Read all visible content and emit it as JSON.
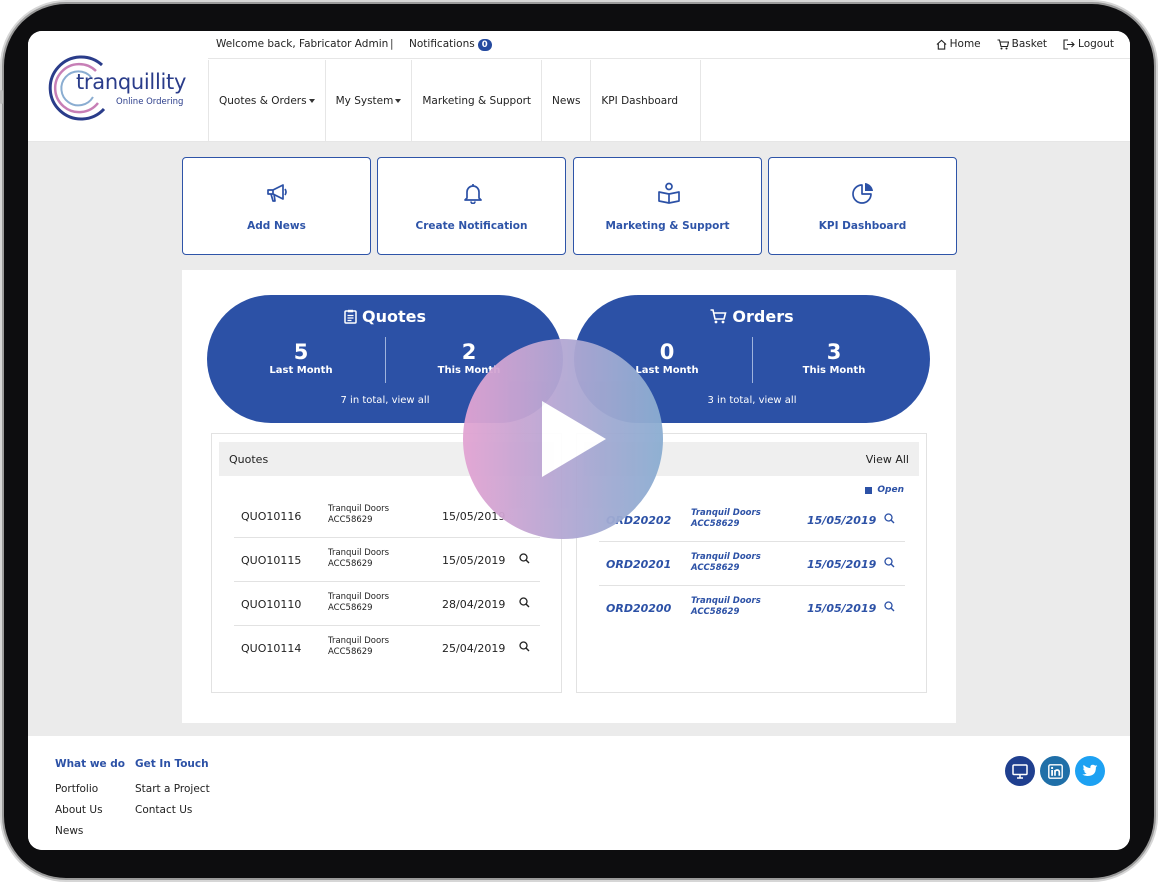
{
  "brand": {
    "name": "tranquillity",
    "tagline": "Online Ordering"
  },
  "topbar": {
    "welcome": "Welcome back, Fabricator Admin",
    "separator": "|",
    "notifications_label": "Notifications",
    "notifications_count": "0",
    "links": [
      {
        "label": "Home",
        "icon": "home-icon"
      },
      {
        "label": "Basket",
        "icon": "basket-icon"
      },
      {
        "label": "Logout",
        "icon": "logout-icon"
      }
    ]
  },
  "nav": [
    {
      "label": "Quotes & Orders",
      "dropdown": true
    },
    {
      "label": "My System",
      "dropdown": true
    },
    {
      "label": "Marketing & Support",
      "dropdown": false
    },
    {
      "label": "News",
      "dropdown": false
    },
    {
      "label": "KPI Dashboard",
      "dropdown": false
    }
  ],
  "tiles": [
    {
      "label": "Add News",
      "icon": "megaphone-icon"
    },
    {
      "label": "Create Notification",
      "icon": "bell-icon"
    },
    {
      "label": "Marketing & Support",
      "icon": "book-user-icon"
    },
    {
      "label": "KPI Dashboard",
      "icon": "pie-chart-icon"
    }
  ],
  "quotes_summary": {
    "title": "Quotes",
    "last_month_value": "5",
    "last_month_label": "Last Month",
    "this_month_value": "2",
    "this_month_label": "This Month",
    "total_text": "7 in total, view all"
  },
  "orders_summary": {
    "title": "Orders",
    "last_month_value": "0",
    "last_month_label": "Last Month",
    "this_month_value": "3",
    "this_month_label": "This Month",
    "total_text": "3 in total, view all"
  },
  "quotes_list": {
    "heading": "Quotes",
    "rows": [
      {
        "id": "QUO10116",
        "customer": "Tranquil Doors",
        "account": "ACC58629",
        "date": "15/05/2019"
      },
      {
        "id": "QUO10115",
        "customer": "Tranquil Doors",
        "account": "ACC58629",
        "date": "15/05/2019"
      },
      {
        "id": "QUO10110",
        "customer": "Tranquil Doors",
        "account": "ACC58629",
        "date": "28/04/2019"
      },
      {
        "id": "QUO10114",
        "customer": "Tranquil Doors",
        "account": "ACC58629",
        "date": "25/04/2019"
      }
    ]
  },
  "orders_list": {
    "view_all": "View All",
    "legend_open": "Open",
    "rows": [
      {
        "id": "ORD20202",
        "customer": "Tranquil Doors",
        "account": "ACC58629",
        "date": "15/05/2019"
      },
      {
        "id": "ORD20201",
        "customer": "Tranquil Doors",
        "account": "ACC58629",
        "date": "15/05/2019"
      },
      {
        "id": "ORD20200",
        "customer": "Tranquil Doors",
        "account": "ACC58629",
        "date": "15/05/2019"
      }
    ]
  },
  "footer": {
    "col1": {
      "heading": "What we do",
      "items": [
        "Portfolio",
        "About Us",
        "News"
      ]
    },
    "col2": {
      "heading": "Get In Touch",
      "items": [
        "Start a Project",
        "Contact Us"
      ]
    },
    "social": [
      {
        "icon": "monitor-icon",
        "color": "#1f3f8f"
      },
      {
        "icon": "linkedin-icon",
        "color": "#1f6fa8"
      },
      {
        "icon": "twitter-icon",
        "color": "#1da1f2"
      }
    ]
  },
  "colors": {
    "primary": "#2c51a6",
    "background": "#ebebeb"
  }
}
